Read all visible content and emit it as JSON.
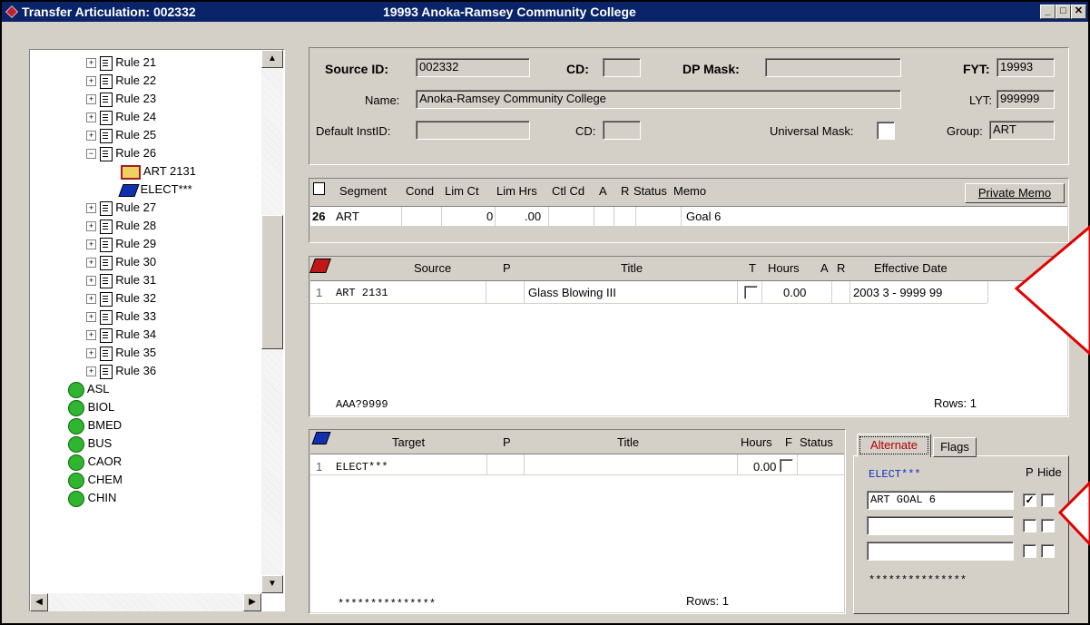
{
  "window": {
    "title": "Transfer Articulation: 002332",
    "institution": "19993  Anoka-Ramsey Community College",
    "min": "_",
    "max": "□",
    "close": "✕"
  },
  "tree": {
    "rules": [
      "Rule 21",
      "Rule 22",
      "Rule 23",
      "Rule 24",
      "Rule 25",
      "Rule 26"
    ],
    "rule26_children": [
      "ART 2131",
      "ELECT***"
    ],
    "rules2": [
      "Rule 27",
      "Rule 28",
      "Rule 29",
      "Rule 30",
      "Rule 31",
      "Rule 32",
      "Rule 33",
      "Rule 34",
      "Rule 35",
      "Rule 36"
    ],
    "subjects": [
      "ASL",
      "BIOL",
      "BMED",
      "BUS",
      "CAOR",
      "CHEM",
      "CHIN"
    ]
  },
  "header": {
    "source_id_label": "Source ID:",
    "source_id": "002332",
    "cd_label": "CD:",
    "cd": "",
    "dp_mask_label": "DP Mask:",
    "dp_mask": "",
    "fyt_label": "FYT:",
    "fyt": "19993",
    "name_label": "Name:",
    "name": "Anoka-Ramsey Community College",
    "lyt_label": "LYT:",
    "lyt": "999999",
    "default_inst_label": "Default InstID:",
    "default_inst": "",
    "cd2_label": "CD:",
    "cd2": "",
    "universal_mask_label": "Universal Mask:",
    "group_label": "Group:",
    "group": "ART"
  },
  "segment": {
    "headers": [
      "Segment",
      "Cond",
      "Lim Ct",
      "Lim Hrs",
      "Ctl Cd",
      "A",
      "R",
      "Status",
      "Memo"
    ],
    "row": {
      "num": "26",
      "segment": "ART",
      "lim_ct": "0",
      "lim_hrs": ".00",
      "memo": "Goal 6"
    },
    "private_memo": "Private Memo"
  },
  "source": {
    "headers": [
      "Source",
      "P",
      "Title",
      "T",
      "Hours",
      "A",
      "R",
      "Effective Date"
    ],
    "row": {
      "num": "1",
      "source": "ART 2131",
      "title": "Glass Blowing III",
      "hours": "0.00",
      "effective": "2003 3  - 9999 99"
    },
    "footer_code": "AAA?9999",
    "rows": "Rows: 1"
  },
  "target": {
    "headers": [
      "Target",
      "P",
      "Title",
      "Hours",
      "F",
      "Status"
    ],
    "row": {
      "num": "1",
      "target": "ELECT***",
      "hours": "0.00"
    },
    "footer_code": "***************",
    "rows": "Rows: 1"
  },
  "alternate": {
    "tabs": [
      "Alternate",
      "Flags"
    ],
    "label": "ELECT***",
    "p_label": "P",
    "hide_label": "Hide",
    "values": [
      "ART GOAL 6",
      "",
      ""
    ],
    "checks": [
      "✓",
      "",
      ""
    ],
    "footer": "***************"
  }
}
